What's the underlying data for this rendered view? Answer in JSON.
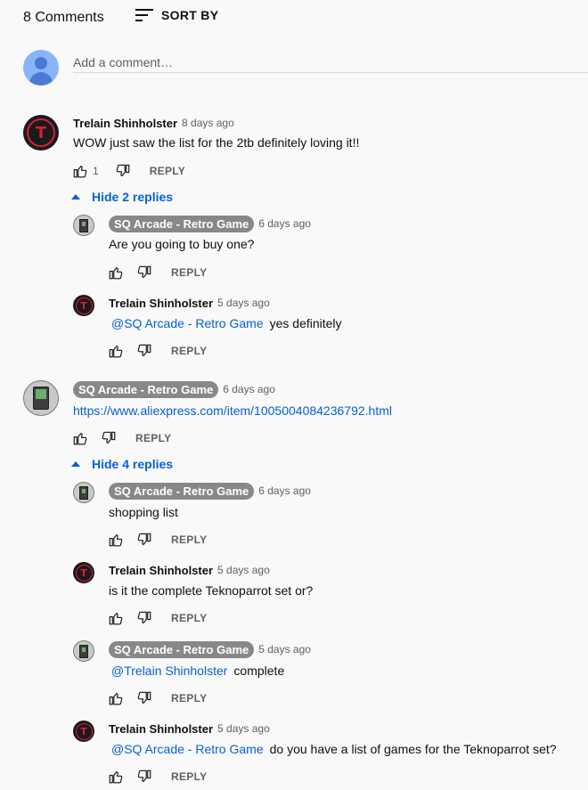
{
  "header": {
    "count": "8 Comments",
    "sort_label": "SORT BY"
  },
  "add_comment": {
    "placeholder": "Add a comment…"
  },
  "threads": [
    {
      "comment": {
        "author": "Trelain Shinholster",
        "time": "8 days ago",
        "text": "WOW just saw the list for the 2tb definitely loving it!!",
        "likes": "1",
        "reply_label": "REPLY"
      },
      "toggle_label": "Hide 2 replies",
      "replies": [
        {
          "author": "SQ Arcade - Retro Game",
          "time": "6 days ago",
          "text": "Are you going to buy one?",
          "reply_label": "REPLY"
        },
        {
          "author": "Trelain Shinholster",
          "time": "5 days ago",
          "mention": "@SQ Arcade - Retro Game",
          "text": "yes definitely",
          "reply_label": "REPLY"
        }
      ]
    },
    {
      "comment": {
        "author": "SQ Arcade - Retro Game",
        "time": "6 days ago",
        "link": "https://www.aliexpress.com/item/1005004084236792.html",
        "reply_label": "REPLY"
      },
      "toggle_label": "Hide 4 replies",
      "replies": [
        {
          "author": "SQ Arcade - Retro Game",
          "time": "6 days ago",
          "text": "shopping list",
          "reply_label": "REPLY"
        },
        {
          "author": "Trelain Shinholster",
          "time": "5 days ago",
          "text": "is it the complete Teknoparrot set or?",
          "reply_label": "REPLY"
        },
        {
          "author": "SQ Arcade - Retro Game",
          "time": "5 days ago",
          "mention": "@Trelain Shinholster",
          "text": "complete",
          "reply_label": "REPLY"
        },
        {
          "author": "Trelain Shinholster",
          "time": "5 days ago",
          "mention": "@SQ Arcade - Retro Game",
          "text": "do you have a list of games for the Teknoparrot set?",
          "reply_label": "REPLY"
        }
      ]
    }
  ],
  "colors": {
    "link": "#065fd4",
    "chip": "#888888",
    "text": "#0f0f0f",
    "secondary": "#606060",
    "background": "#f9f9f9"
  },
  "icons": [
    "sort-icon",
    "thumbs-up-icon",
    "thumbs-down-icon",
    "caret-up-icon",
    "user-avatar-icon"
  ]
}
